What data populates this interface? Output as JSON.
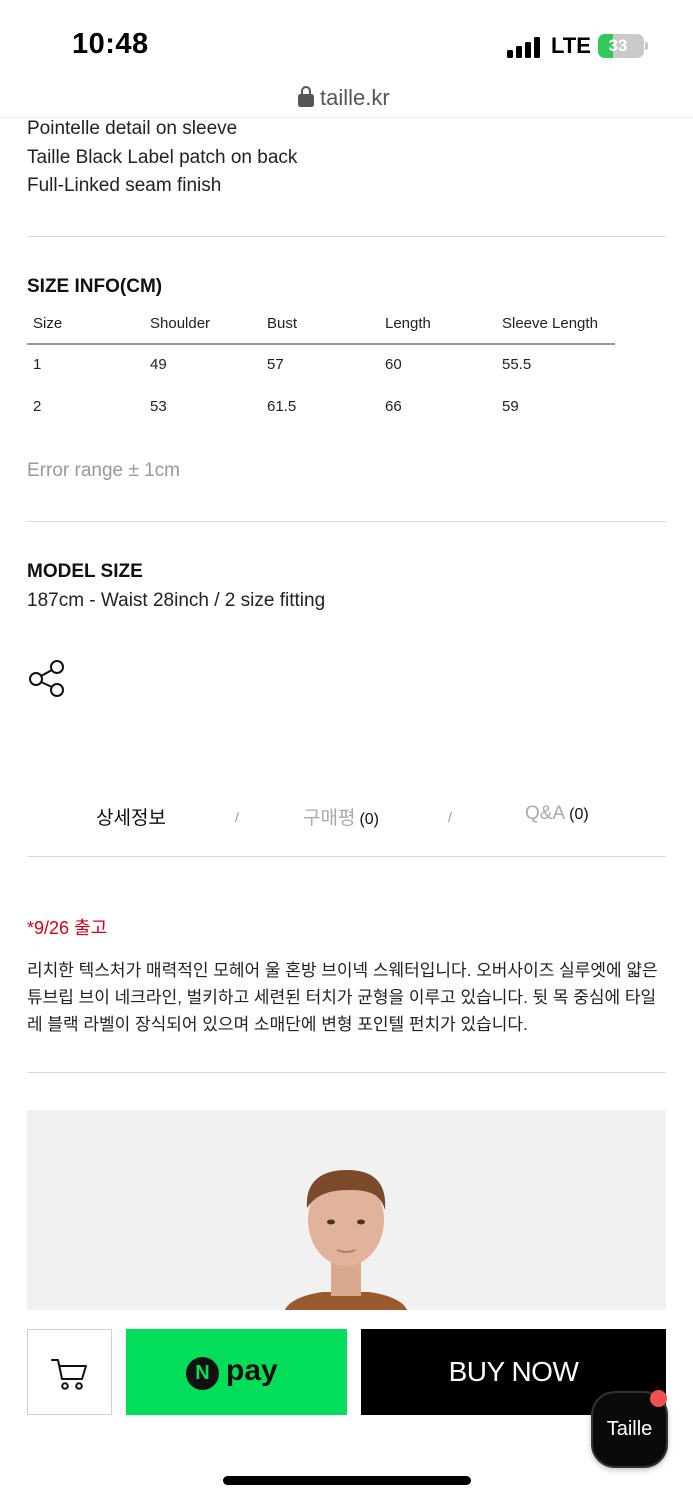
{
  "status_bar": {
    "time": "10:48",
    "network": "LTE",
    "battery": "33",
    "battery_level": 0.33,
    "battery_color": "#34c759"
  },
  "browser": {
    "url": "taille.kr",
    "lock_icon": "lock-icon"
  },
  "product": {
    "features": [
      "Pointelle detail on sleeve",
      "Taille Black Label patch on back",
      "Full-Linked seam finish"
    ],
    "size_info": {
      "title": "SIZE INFO(CM)",
      "headers": [
        "Size",
        "Shoulder",
        "Bust",
        "Length",
        "Sleeve Length"
      ],
      "rows": [
        [
          "1",
          "49",
          "57",
          "60",
          "55.5"
        ],
        [
          "2",
          "53",
          "61.5",
          "66",
          "59"
        ]
      ],
      "note": "Error range ± 1cm"
    },
    "model_size": {
      "title": "MODEL SIZE",
      "text": "187cm - Waist 28inch / 2 size fitting"
    },
    "share_icon": "share-icon"
  },
  "tabs": {
    "detail": "상세정보",
    "review": "구매평",
    "review_count": "(0)",
    "qa": "Q&A",
    "qa_count": "(0)",
    "separator": "/"
  },
  "description": {
    "release": "*9/26 출고",
    "body": "리치한 텍스처가 매력적인 모헤어 울 혼방 브이넥 스웨터입니다. 오버사이즈 실루엣에 얇은 튜브립 브이 네크라인, 벌키하고 세련된 터치가 균형을 이루고 있습니다. 뒷 목 중심에 타일레 블랙 라벨이 장식되어 있으며 소매단에 변형 포인텔 펀치가 있습니다.",
    "release_color": "#d0021b"
  },
  "bottom_bar": {
    "cart_icon": "cart-icon",
    "npay_logo": "N",
    "npay_text": "pay",
    "npay_color": "#03de5a",
    "buy_now": "BUY NOW",
    "chat_label": "Taille"
  }
}
